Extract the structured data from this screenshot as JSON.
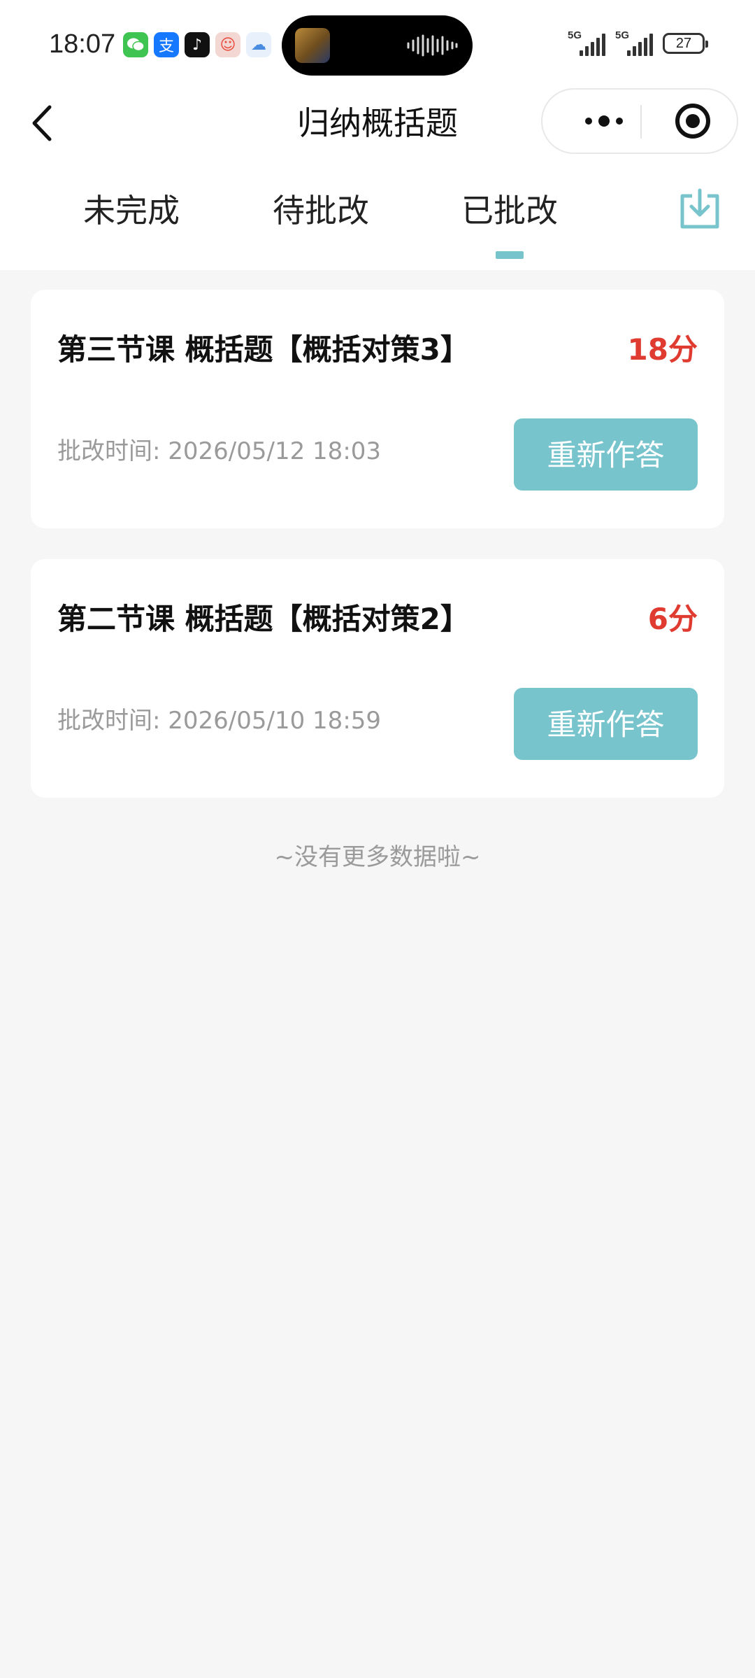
{
  "status_bar": {
    "time": "18:07",
    "app_icons": [
      {
        "name": "wechat-icon",
        "color": "#3fc451",
        "glyph": "✆"
      },
      {
        "name": "alipay-icon",
        "color": "#1677ff",
        "glyph": "支"
      },
      {
        "name": "tiktok-icon",
        "color": "#111111",
        "glyph": "♪"
      },
      {
        "name": "game-app-icon",
        "color": "#e9493b",
        "glyph": "☺"
      },
      {
        "name": "cloud-app-icon",
        "color": "#4a8de0",
        "glyph": "☁"
      }
    ],
    "network_1": "5G",
    "network_2": "5G",
    "battery": "27"
  },
  "nav": {
    "title": "归纳概括题"
  },
  "tabs": {
    "items": [
      "未完成",
      "待批改",
      "已批改"
    ],
    "active_index": 2,
    "accent_color": "#78c4cc"
  },
  "list": {
    "items": [
      {
        "title": "第三节课 概括题【概括对策3】",
        "score": "18分",
        "time_label": "批改时间:",
        "time_value": "2026/05/12 18:03",
        "action": "重新作答"
      },
      {
        "title": "第二节课 概括题【概括对策2】",
        "score": "6分",
        "time_label": "批改时间:",
        "time_value": "2026/05/10 18:59",
        "action": "重新作答"
      }
    ],
    "end_hint": "~没有更多数据啦~"
  },
  "colors": {
    "score": "#e03b30",
    "button": "#78c4cc",
    "background": "#f6f6f6"
  }
}
